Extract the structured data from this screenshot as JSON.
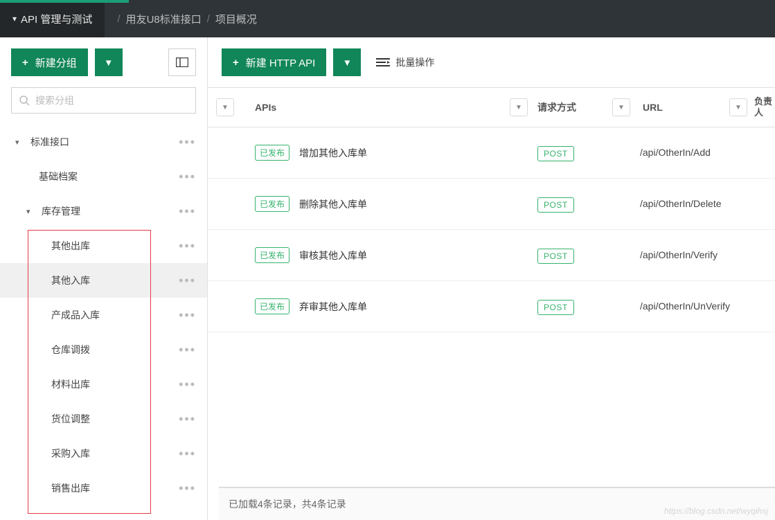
{
  "topbar": {
    "title": "API 管理与测试",
    "crumb1": "用友U8标准接口",
    "crumb2": "项目概况"
  },
  "sidebar": {
    "new_group_label": "新建分组",
    "search_placeholder": "搜索分组",
    "tree": {
      "standard": "标准接口",
      "basic": "基础档案",
      "inventory": "库存管理",
      "children": [
        "其他出库",
        "其他入库",
        "产成品入库",
        "仓库调拨",
        "材料出库",
        "货位调整",
        "采购入库",
        "销售出库"
      ]
    }
  },
  "main": {
    "new_api_label": "新建 HTTP API",
    "batch_label": "批量操作",
    "columns": {
      "api": "APIs",
      "method": "请求方式",
      "url": "URL",
      "resp": "负责人"
    },
    "published_label": "已发布",
    "post_label": "POST",
    "rows": [
      {
        "name": "增加其他入库单",
        "url": "/api/OtherIn/Add"
      },
      {
        "name": "删除其他入库单",
        "url": "/api/OtherIn/Delete"
      },
      {
        "name": "审核其他入库单",
        "url": "/api/OtherIn/Verify"
      },
      {
        "name": "弃审其他入库单",
        "url": "/api/OtherIn/UnVerify"
      }
    ],
    "status": "已加载4条记录，共4条记录"
  },
  "watermark": "https://blog.csdn.net/wyqihsj"
}
